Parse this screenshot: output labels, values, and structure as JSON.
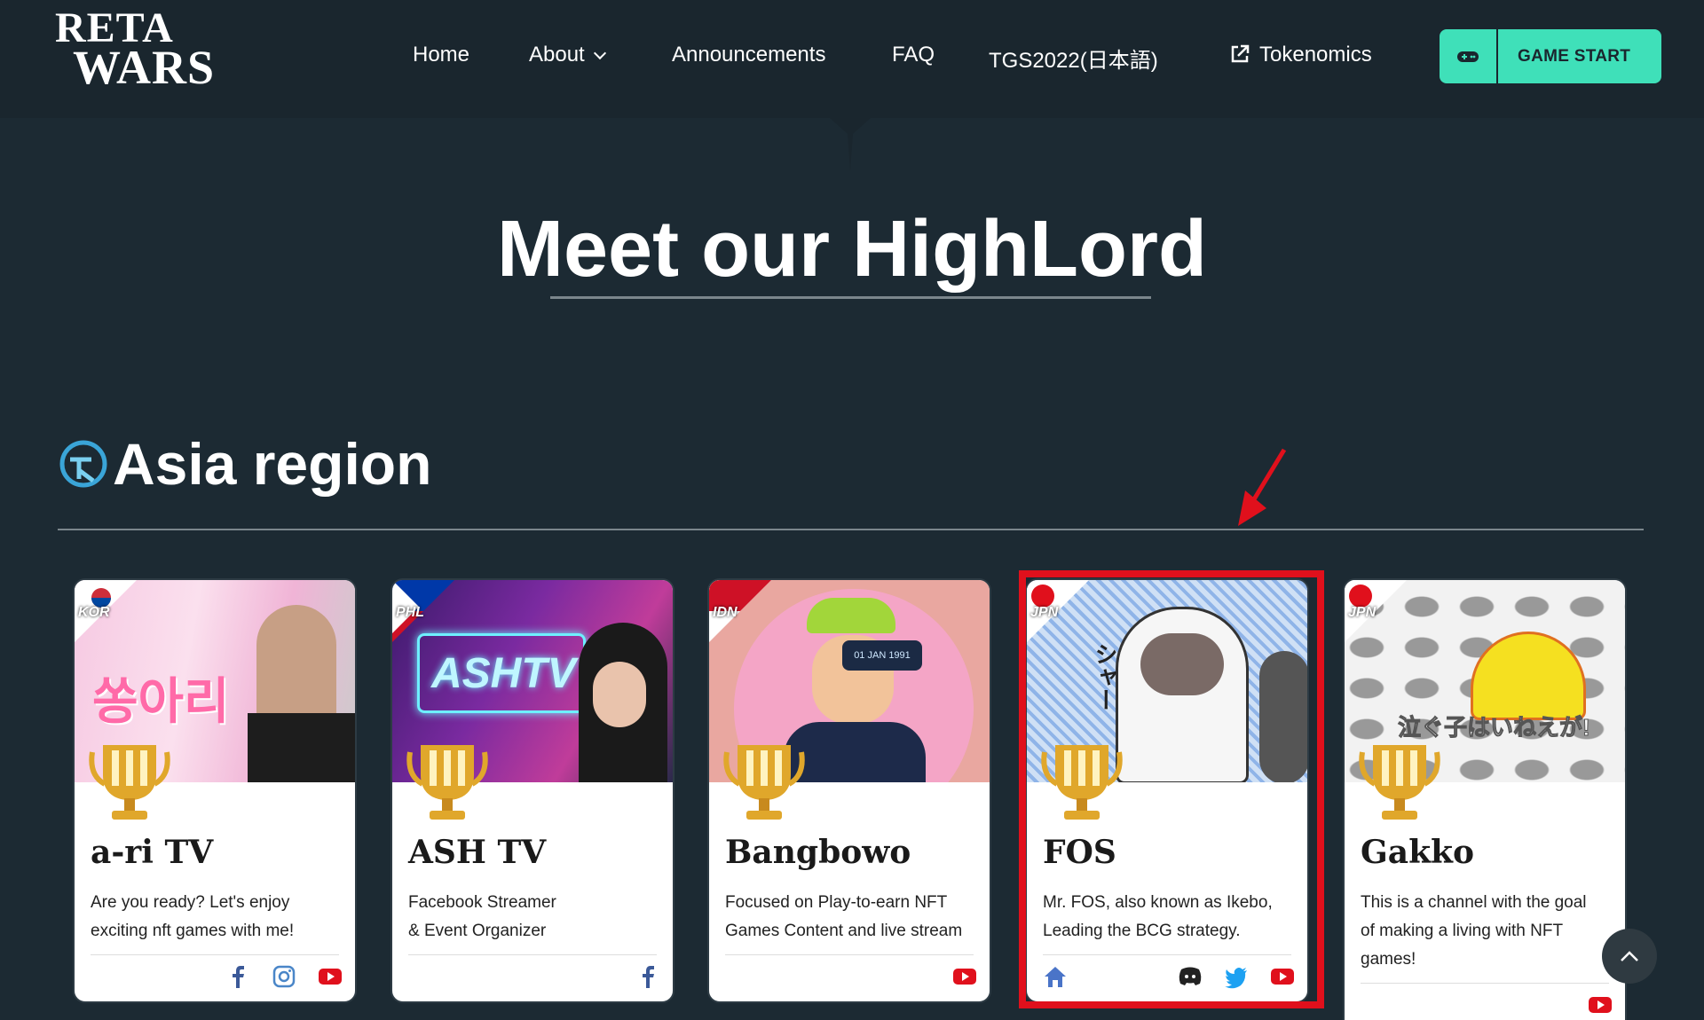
{
  "header": {
    "logo_line1": "RETA",
    "logo_line2": "WARS",
    "nav": [
      "Home",
      "About",
      "Announcements",
      "FAQ",
      "TGS2022(日本語)",
      "Tokenomics"
    ],
    "start_label": "GAME START"
  },
  "page_title": "Meet our HighLord",
  "region_title": "Asia region",
  "cards": [
    {
      "name": "a-ri TV",
      "flag": "KOR",
      "desc": [
        "Are you ready? Let's enjoy",
        "exciting nft games with me!"
      ],
      "img_text": "쏭아리",
      "socials": [
        "facebook-icon",
        "instagram-icon",
        "youtube-icon"
      ]
    },
    {
      "name": "ASH TV",
      "flag": "PHL",
      "desc": [
        "Facebook Streamer",
        "& Event Organizer"
      ],
      "img_text": "ASHTV",
      "socials": [
        "facebook-icon"
      ]
    },
    {
      "name": "Bangbowo",
      "flag": "IDN",
      "desc": [
        "Focused on Play-to-earn NFT",
        "Games Content and live stream"
      ],
      "img_text": "01 JAN 1991",
      "socials": [
        "youtube-icon"
      ]
    },
    {
      "name": "FOS",
      "flag": "JPN",
      "desc": [
        "Mr. FOS, also known as Ikebo,",
        "Leading the BCG strategy."
      ],
      "img_text": "シャー",
      "socials": [
        "home-icon",
        "discord-icon",
        "twitter-icon",
        "youtube-icon"
      ]
    },
    {
      "name": "Gakko",
      "flag": "JPN",
      "desc": [
        "This is a channel with the goal",
        "of making a living with NFT",
        "games!"
      ],
      "img_text": "泣ぐ子はいねえが!",
      "socials": [
        "youtube-icon"
      ]
    }
  ],
  "colors": {
    "accent": "#3fe0b9",
    "bg": "#1c2a33",
    "highlight": "#e0101c"
  }
}
